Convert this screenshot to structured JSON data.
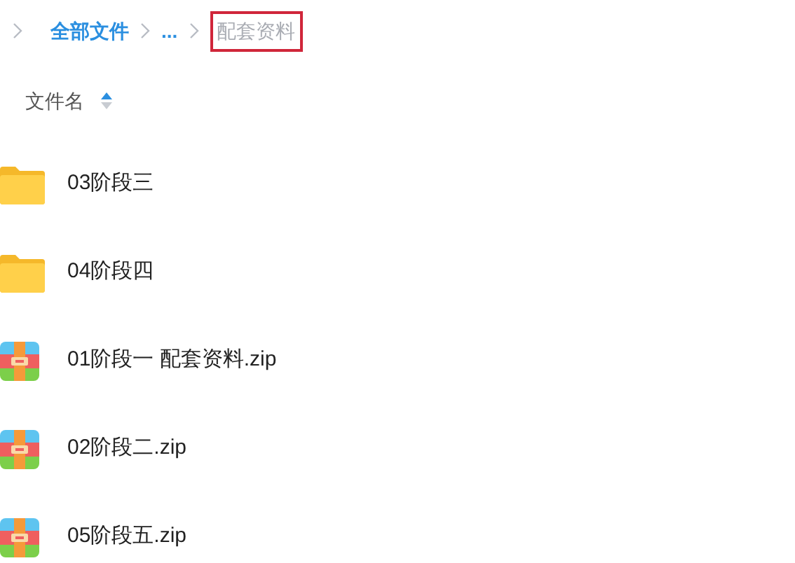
{
  "breadcrumb": [
    {
      "label": "全部文件",
      "kind": "link",
      "highlighted": false
    },
    {
      "label": "...",
      "kind": "link",
      "highlighted": false
    },
    {
      "label": "配套资料",
      "kind": "current",
      "highlighted": true
    }
  ],
  "header": {
    "label": "文件名",
    "sort_ascending": true
  },
  "files": [
    {
      "name": "03阶段三",
      "kind": "folder"
    },
    {
      "name": "04阶段四",
      "kind": "folder"
    },
    {
      "name": "01阶段一 配套资料.zip",
      "kind": "zip"
    },
    {
      "name": "02阶段二.zip",
      "kind": "zip"
    },
    {
      "name": "05阶段五.zip",
      "kind": "zip"
    }
  ]
}
